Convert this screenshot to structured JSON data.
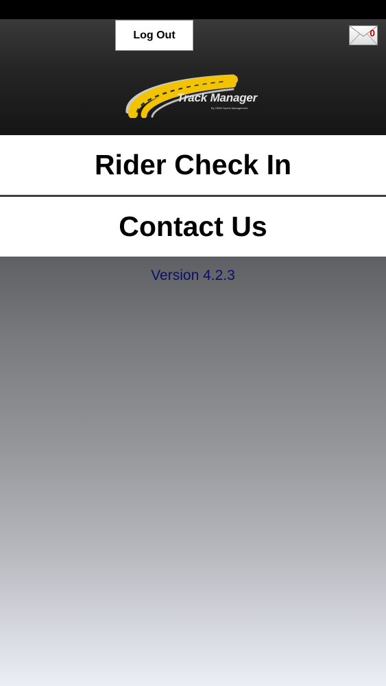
{
  "header": {
    "logout_label": "Log Out",
    "mail_count": "0",
    "logo": {
      "title": "Track Manager",
      "subtitle": "By OMW Sports Management"
    }
  },
  "menu": {
    "rider_checkin_label": "Rider Check In",
    "contact_us_label": "Contact Us"
  },
  "footer": {
    "version": "Version 4.2.3"
  },
  "icons": {
    "mail": "envelope-icon",
    "logo": "track-road-logo-icon"
  },
  "colors": {
    "header_bg": "#262626",
    "logo_yellow": "#f2c300",
    "version_text": "#0b0f6b",
    "mail_count": "#c00000"
  }
}
